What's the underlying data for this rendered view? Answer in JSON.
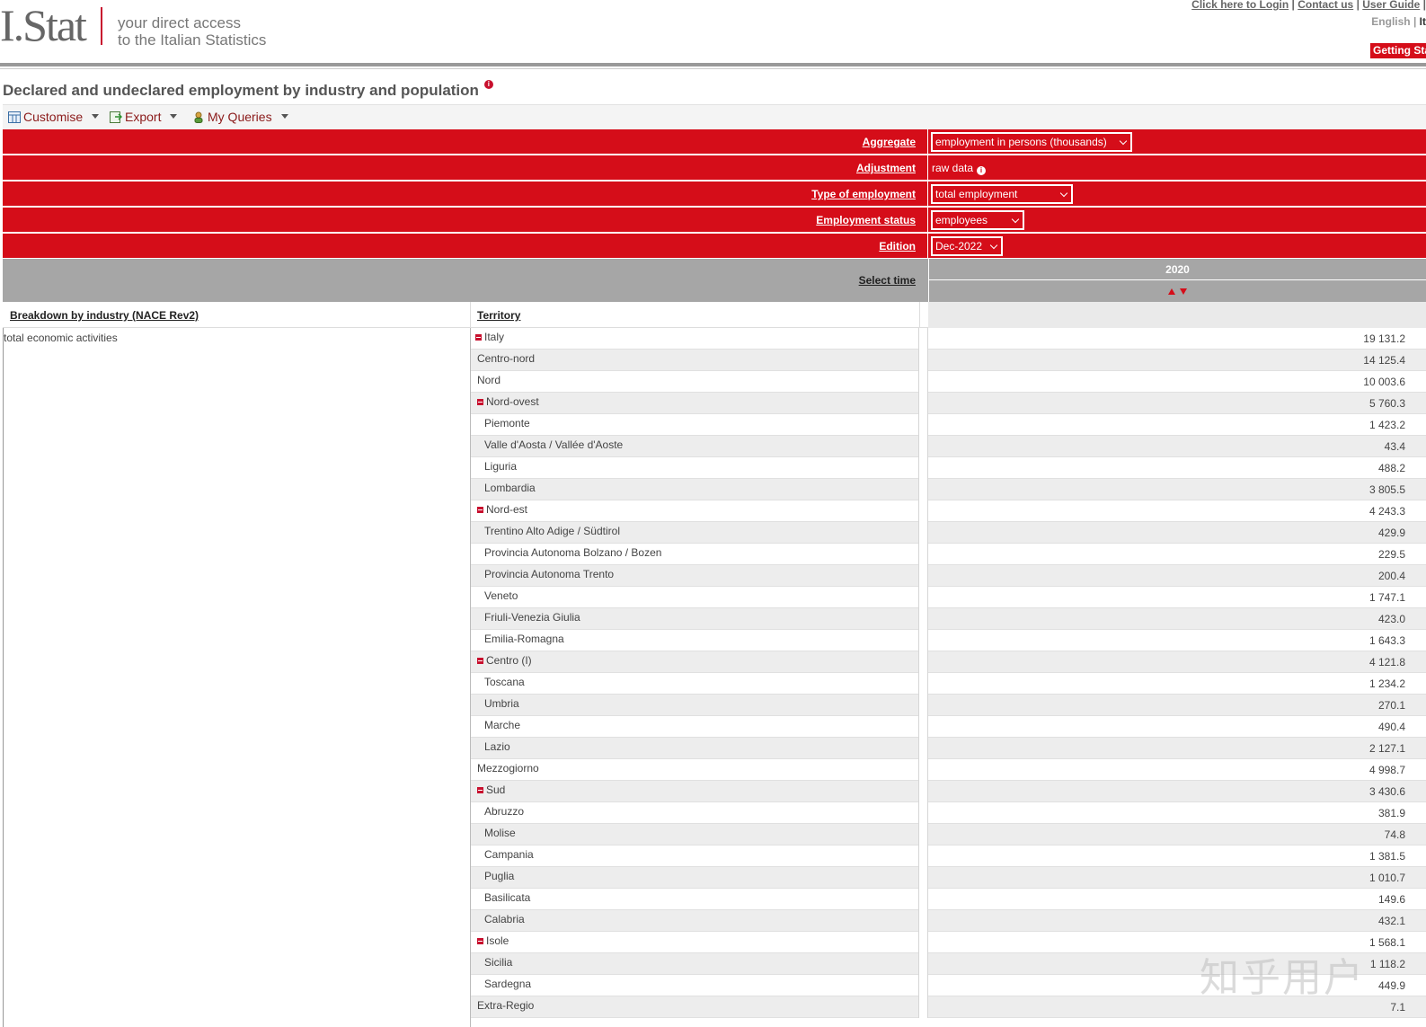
{
  "header": {
    "logo_text": "I.Stat",
    "tagline_line1": "your direct access",
    "tagline_line2": "to the Italian Statistics",
    "login_link": "Click here to Login",
    "contact_link": "Contact us",
    "guide_link": "User Guide",
    "lang_english": "English",
    "lang_italian": "It",
    "getting_started": "Getting Sta"
  },
  "page": {
    "title": "Declared and undeclared employment by industry and population"
  },
  "toolbar": {
    "customise": "Customise",
    "export": "Export",
    "my_queries": "My Queries"
  },
  "selectors": {
    "aggregate_label": "Aggregate",
    "aggregate_value": "employment in persons (thousands)",
    "adjustment_label": "Adjustment",
    "adjustment_value": "raw data",
    "type_label": "Type of employment",
    "type_value": "total employment",
    "status_label": "Employment status",
    "status_value": "employees",
    "edition_label": "Edition",
    "edition_value": "Dec-2022"
  },
  "time": {
    "label": "Select time",
    "year": "2020"
  },
  "columns": {
    "breakdown": "Breakdown by industry (NACE Rev2)",
    "territory": "Territory"
  },
  "industry": "total economic activities",
  "table_rows": [
    {
      "territory": "Italy",
      "value": "19 131.2",
      "indent": 0,
      "collapsible": true
    },
    {
      "territory": "Centro-nord",
      "value": "14 125.4",
      "indent": 1,
      "collapsible": false
    },
    {
      "territory": "Nord",
      "value": "10 003.6",
      "indent": 1,
      "collapsible": false
    },
    {
      "territory": "Nord-ovest",
      "value": "5 760.3",
      "indent": 2,
      "collapsible": true
    },
    {
      "territory": "Piemonte",
      "value": "1 423.2",
      "indent": 3,
      "collapsible": false
    },
    {
      "territory": "Valle d'Aosta / Vallée d'Aoste",
      "value": "43.4",
      "indent": 3,
      "collapsible": false
    },
    {
      "territory": "Liguria",
      "value": "488.2",
      "indent": 3,
      "collapsible": false
    },
    {
      "territory": "Lombardia",
      "value": "3 805.5",
      "indent": 3,
      "collapsible": false
    },
    {
      "territory": "Nord-est",
      "value": "4 243.3",
      "indent": 2,
      "collapsible": true
    },
    {
      "territory": "Trentino Alto Adige / Südtirol",
      "value": "429.9",
      "indent": 3,
      "collapsible": false
    },
    {
      "territory": "Provincia Autonoma Bolzano / Bozen",
      "value": "229.5",
      "indent": 3,
      "collapsible": false
    },
    {
      "territory": "Provincia Autonoma Trento",
      "value": "200.4",
      "indent": 3,
      "collapsible": false
    },
    {
      "territory": "Veneto",
      "value": "1 747.1",
      "indent": 3,
      "collapsible": false
    },
    {
      "territory": "Friuli-Venezia Giulia",
      "value": "423.0",
      "indent": 3,
      "collapsible": false
    },
    {
      "territory": "Emilia-Romagna",
      "value": "1 643.3",
      "indent": 3,
      "collapsible": false
    },
    {
      "territory": "Centro (I)",
      "value": "4 121.8",
      "indent": 2,
      "collapsible": true
    },
    {
      "territory": "Toscana",
      "value": "1 234.2",
      "indent": 3,
      "collapsible": false
    },
    {
      "territory": "Umbria",
      "value": "270.1",
      "indent": 3,
      "collapsible": false
    },
    {
      "territory": "Marche",
      "value": "490.4",
      "indent": 3,
      "collapsible": false
    },
    {
      "territory": "Lazio",
      "value": "2 127.1",
      "indent": 3,
      "collapsible": false
    },
    {
      "territory": "Mezzogiorno",
      "value": "4 998.7",
      "indent": 1,
      "collapsible": false
    },
    {
      "territory": "Sud",
      "value": "3 430.6",
      "indent": 2,
      "collapsible": true
    },
    {
      "territory": "Abruzzo",
      "value": "381.9",
      "indent": 3,
      "collapsible": false
    },
    {
      "territory": "Molise",
      "value": "74.8",
      "indent": 3,
      "collapsible": false
    },
    {
      "territory": "Campania",
      "value": "1 381.5",
      "indent": 3,
      "collapsible": false
    },
    {
      "territory": "Puglia",
      "value": "1 010.7",
      "indent": 3,
      "collapsible": false
    },
    {
      "territory": "Basilicata",
      "value": "149.6",
      "indent": 3,
      "collapsible": false
    },
    {
      "territory": "Calabria",
      "value": "432.1",
      "indent": 3,
      "collapsible": false
    },
    {
      "territory": "Isole",
      "value": "1 568.1",
      "indent": 2,
      "collapsible": true
    },
    {
      "territory": "Sicilia",
      "value": "1 118.2",
      "indent": 3,
      "collapsible": false
    },
    {
      "territory": "Sardegna",
      "value": "449.9",
      "indent": 3,
      "collapsible": false
    },
    {
      "territory": "Extra-Regio",
      "value": "7.1",
      "indent": 1,
      "collapsible": false
    }
  ],
  "watermark": "知乎用户",
  "colors": {
    "brand_red": "#d50d19",
    "header_grey": "#a6a6a6"
  }
}
